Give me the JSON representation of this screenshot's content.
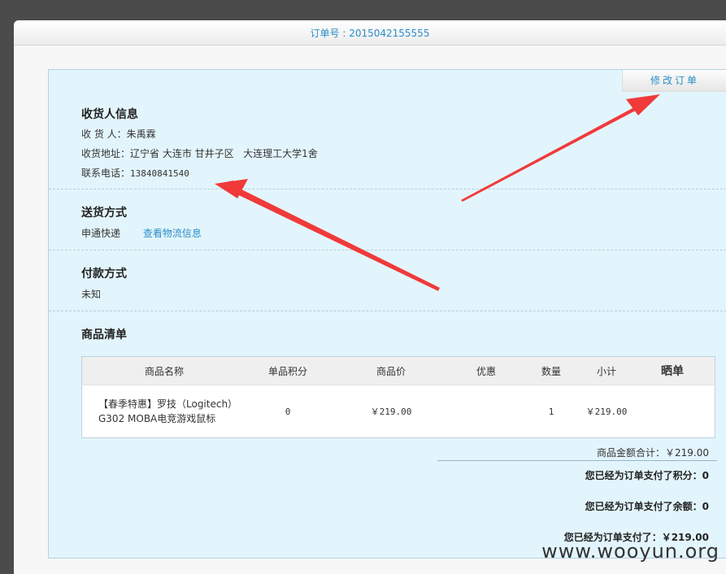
{
  "window": {
    "title": "订单号 : 2015042155555"
  },
  "edit_button": "修改订单",
  "receiver": {
    "heading": "收货人信息",
    "name_label": "收 货 人：",
    "name": "朱禹霖",
    "address_label": "收货地址：",
    "address": "辽宁省 大连市 甘井子区   大连理工大学1舍",
    "phone_label": "联系电话：",
    "phone": "13840841540"
  },
  "delivery": {
    "heading": "送货方式",
    "method": "申通快递",
    "track_link": "查看物流信息"
  },
  "payment": {
    "heading": "付款方式",
    "method": "未知"
  },
  "goods": {
    "heading": "商品清单",
    "columns": [
      "商品名称",
      "单品积分",
      "商品价",
      "优惠",
      "数量",
      "小计",
      "晒单"
    ],
    "rows": [
      {
        "name": "【春季特惠】罗技（Logitech）G302 MOBA电竞游戏鼠标",
        "points": "0",
        "price": "￥219.00",
        "discount": "",
        "qty": "1",
        "subtotal": "￥219.00",
        "show": ""
      }
    ]
  },
  "summary": {
    "total": "商品金额合计：￥219.00",
    "paid_points": "您已经为订单支付了积分：0",
    "paid_balance": "您已经为订单支付了余额：0",
    "paid_amount": "您已经为订单支付了：￥219.00"
  },
  "watermark": "www.wooyun.org",
  "colors": {
    "accent": "#2a8ec7",
    "panel": "#e3f5fc",
    "arrow": "#f03a3a"
  }
}
